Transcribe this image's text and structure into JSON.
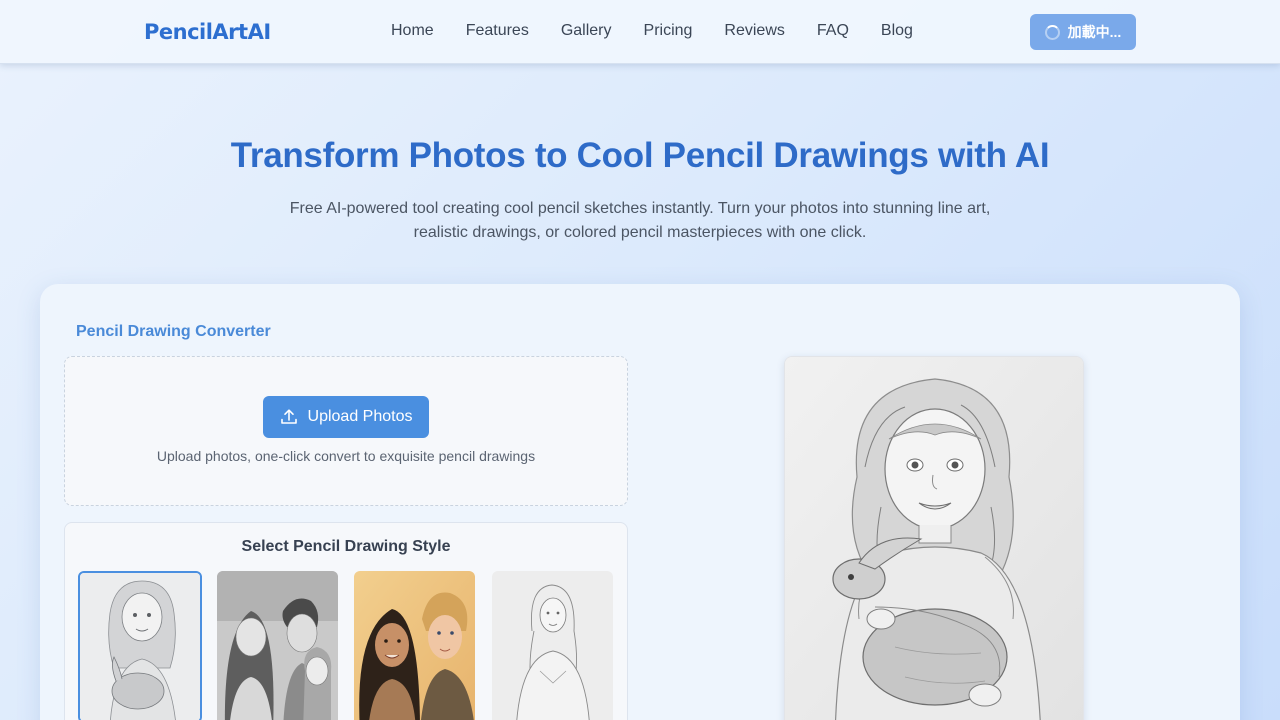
{
  "header": {
    "logo": "PencilArtAI",
    "nav": [
      "Home",
      "Features",
      "Gallery",
      "Pricing",
      "Reviews",
      "FAQ",
      "Blog"
    ],
    "login_label": "加載中..."
  },
  "hero": {
    "title": "Transform Photos to Cool Pencil Drawings with AI",
    "subtitle_line1": "Free AI-powered tool creating cool pencil sketches instantly. Turn your photos into stunning line art,",
    "subtitle_line2": "realistic drawings, or colored pencil masterpieces with one click."
  },
  "converter": {
    "label": "Pencil Drawing Converter",
    "upload_button": "Upload Photos",
    "upload_hint": "Upload photos, one-click convert to exquisite pencil drawings",
    "style_title": "Select Pencil Drawing Style"
  },
  "icons": {
    "upload": "upload-icon",
    "spinner": "loading-spinner-icon"
  },
  "colors": {
    "brand": "#2d6fd0",
    "button": "#4a8fe0",
    "login_button": "#7aa9ea"
  }
}
